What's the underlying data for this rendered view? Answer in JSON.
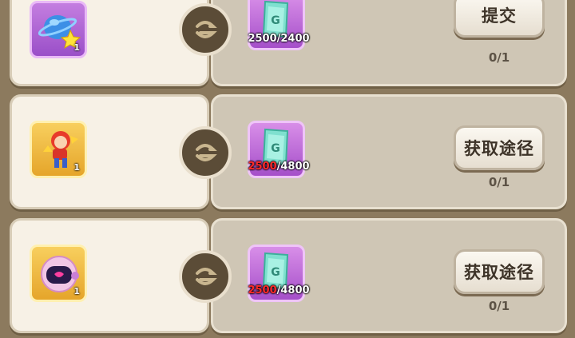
{
  "rows": [
    {
      "item_icon": "planet-star-icon",
      "item_qty": "1",
      "card_icon": "green-scroll-card-icon",
      "count_have": "2500",
      "count_need": "/2400",
      "count_have_color": "#ffffff",
      "button_label": "提交",
      "progress": "0/1"
    },
    {
      "item_icon": "hero-character-icon",
      "item_qty": "1",
      "card_icon": "green-scroll-card-icon",
      "count_have": "2500",
      "count_need": "/4800",
      "count_have_color": "#ff2a2a",
      "button_label": "获取途径",
      "progress": "0/1"
    },
    {
      "item_icon": "space-helmet-icon",
      "item_qty": "1",
      "card_icon": "green-scroll-card-icon",
      "count_have": "2500",
      "count_need": "/4800",
      "count_have_color": "#ff2a2a",
      "button_label": "获取途径",
      "progress": "0/1"
    }
  ]
}
